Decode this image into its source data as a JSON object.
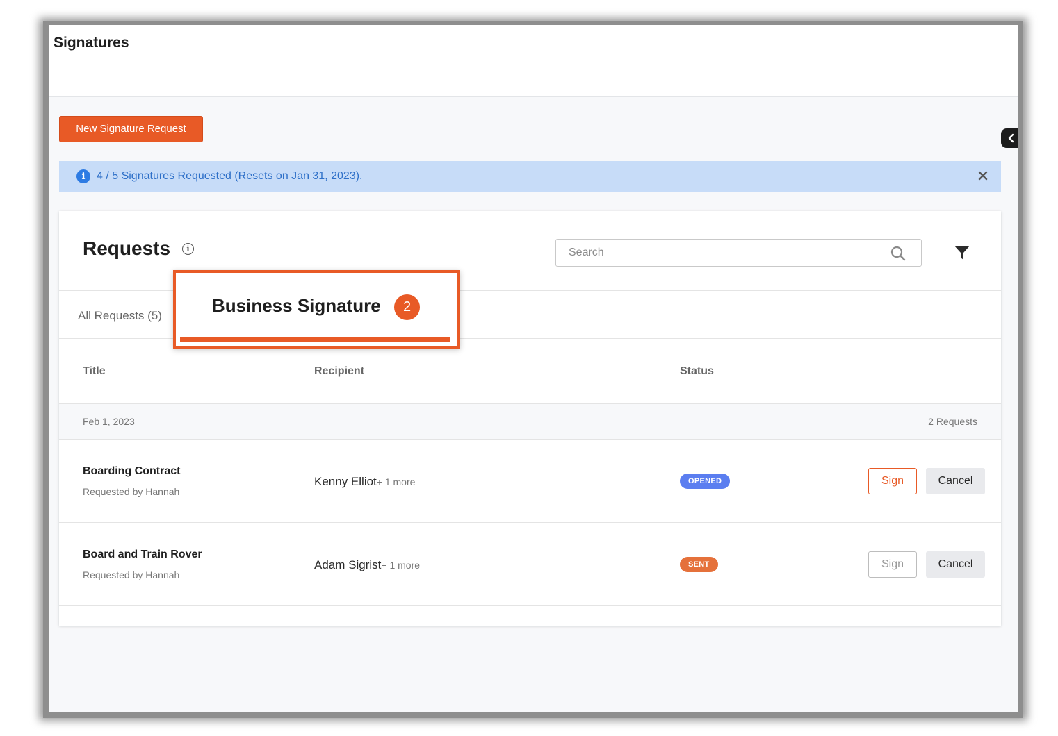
{
  "app": {
    "title": "Signatures"
  },
  "actions": {
    "new_request_label": "New Signature Request"
  },
  "alert": {
    "text": "4 / 5 Signatures Requested (Resets on Jan 31, 2023)."
  },
  "requests": {
    "title": "Requests",
    "search_placeholder": "Search",
    "tabs": [
      {
        "label": "All Requests (5)"
      },
      {
        "label": "Business Signature",
        "badge": "2",
        "active": true
      }
    ],
    "columns": {
      "title": "Title",
      "recipient": "Recipient",
      "status": "Status"
    },
    "group": {
      "date": "Feb 1, 2023",
      "count": "2 Requests"
    },
    "rows": [
      {
        "title": "Boarding Contract",
        "requested_by": "Requested by Hannah",
        "recipient": "Kenny Elliot",
        "more": "+ 1 more",
        "status": "OPENED",
        "status_color": "#5b7ef0",
        "sign_label": "Sign",
        "sign_enabled": true,
        "cancel_label": "Cancel"
      },
      {
        "title": "Board and Train Rover",
        "requested_by": "Requested by Hannah",
        "recipient": "Adam Sigrist",
        "more": "+ 1 more",
        "status": "SENT",
        "status_color": "#e5713b",
        "sign_label": "Sign",
        "sign_enabled": false,
        "cancel_label": "Cancel"
      }
    ]
  },
  "colors": {
    "accent": "#e85a26",
    "info_bg": "#c7dcf8",
    "info_text": "#2d6fc8"
  }
}
